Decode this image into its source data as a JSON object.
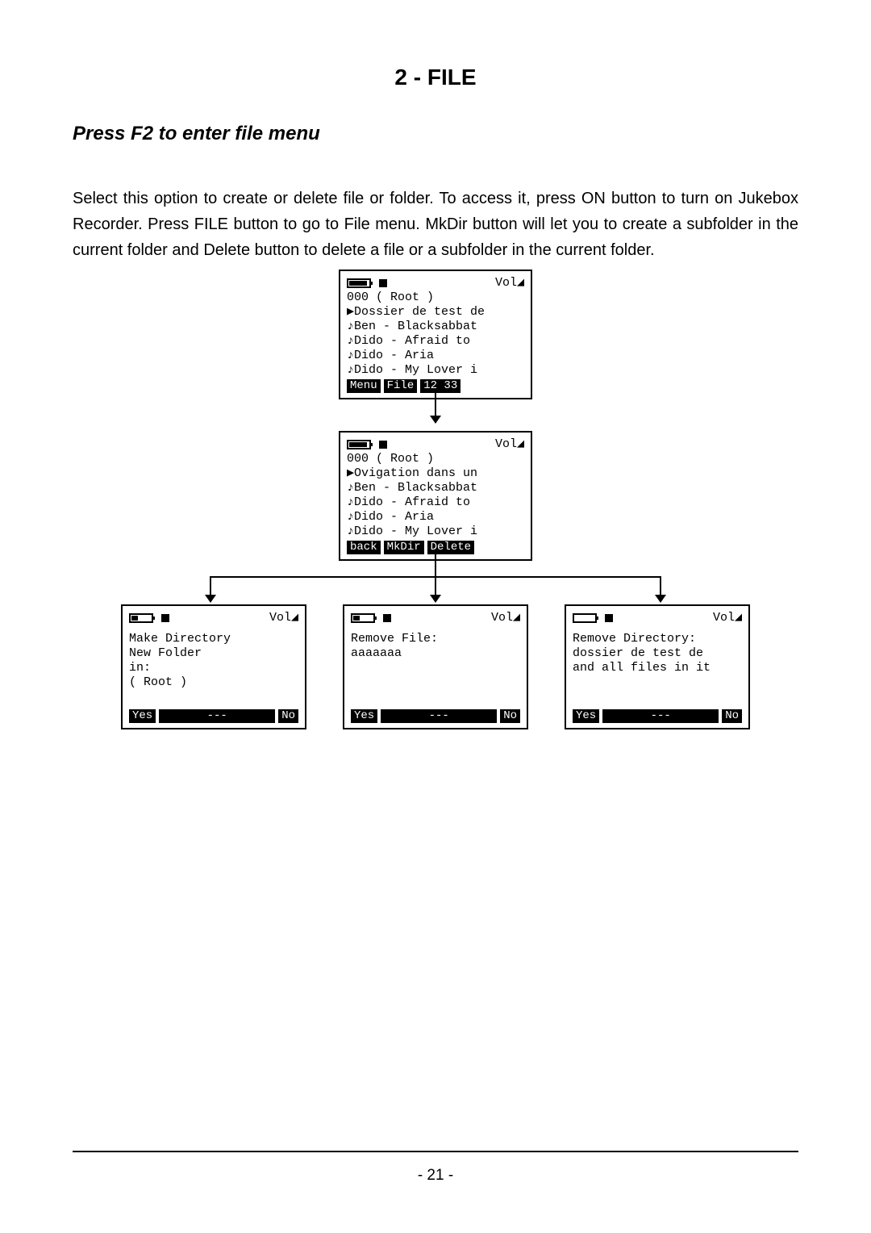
{
  "title_num": "2 - ",
  "title_word": "FILE",
  "subhead": "Press F2 to enter file menu",
  "body": "Select this option to create or delete file or folder. To access it, press ON button to turn on Jukebox Recorder. Press FILE button to go to File menu. MkDir button will let you to create a subfolder in the current folder and Delete button to delete a file or a subfolder in the current folder.",
  "page_num": "- 21 -",
  "screen1": {
    "vol": "Vol◢",
    "line2": "000 ( Root )",
    "line3": "▶Dossier de test de",
    "line4": " ♪Ben - Blacksabbat",
    "line5": " ♪Dido - Afraid to",
    "line6": " ♪Dido - Aria",
    "line7": " ♪Dido - My Lover i",
    "f1": "Menu",
    "f2": "File",
    "f3": "12 33"
  },
  "screen2": {
    "vol": "Vol◢",
    "line2": "000 ( Root )",
    "line3": "▶Ovigation dans un",
    "line4": " ♪Ben - Blacksabbat",
    "line5": " ♪Dido - Afraid to",
    "line6": " ♪Dido - Aria",
    "line7": " ♪Dido - My Lover i",
    "f1": "back",
    "f2": "MkDir",
    "f3": "Delete"
  },
  "screen3": {
    "vol": "Vol◢",
    "l1": "Make Directory",
    "l2": "New Folder",
    "l3": "in:",
    "l4": "( Root )",
    "f1": "Yes",
    "f2": "---",
    "f3": "No"
  },
  "screen4": {
    "vol": "Vol◢",
    "l1": "Remove File:",
    "l2": "aaaaaaa",
    "f1": "Yes",
    "f2": "---",
    "f3": "No"
  },
  "screen5": {
    "vol": "Vol◢",
    "l1": "Remove Directory:",
    "l2": "dossier de test de",
    "l3": "and all files in it",
    "f1": "Yes",
    "f2": "---",
    "f3": "No"
  }
}
